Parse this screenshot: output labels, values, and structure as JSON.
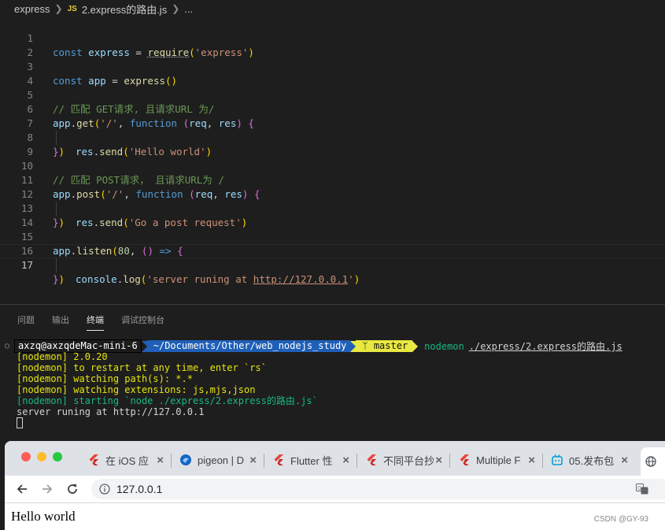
{
  "breadcrumb": {
    "folder": "express",
    "file_badge": "JS",
    "file": "2.express的路由.js",
    "more": "..."
  },
  "editor": {
    "lines": [
      {
        "n": "1"
      },
      {
        "n": "2"
      },
      {
        "n": "3"
      },
      {
        "n": "4"
      },
      {
        "n": "5"
      },
      {
        "n": "6"
      },
      {
        "n": "7"
      },
      {
        "n": "8"
      },
      {
        "n": "9"
      },
      {
        "n": "10"
      },
      {
        "n": "11"
      },
      {
        "n": "12"
      },
      {
        "n": "13"
      },
      {
        "n": "14"
      },
      {
        "n": "15"
      },
      {
        "n": "16"
      },
      {
        "n": "17"
      }
    ],
    "tokens": {
      "const": "const",
      "express": "express",
      "eq": " = ",
      "require": "require",
      "s_express": "'express'",
      "app": "app",
      "express_fn": "express",
      "c1": "// 匹配 GET请求, 且请求URL 为/",
      "get": "get",
      "s_root": "'/'",
      "function": "function",
      "req": "req",
      "res": "res",
      "send": "send",
      "s_hello": "'Hello world'",
      "c2": "// 匹配 POST请求， 且请求URL为 /",
      "post": "post",
      "s_post": "'Go a post request'",
      "listen": "listen",
      "n80": "80",
      "arrow": " => ",
      "console": "console",
      "log": "log",
      "s_srv_a": "'server runing at ",
      "s_srv_url": "http://127.0.0.1",
      "s_srv_b": "'"
    }
  },
  "panel": {
    "tabs": [
      {
        "label": "问题"
      },
      {
        "label": "输出"
      },
      {
        "label": "终端"
      },
      {
        "label": "调试控制台"
      }
    ]
  },
  "terminal": {
    "user": "axzq@axzqdeMac-mini-6",
    "path": "~/Documents/Other/web_nodejs_study",
    "branch": "ᛘ master",
    "command": "nodemon",
    "command_arg": "./express/2.express的路由.js",
    "output": [
      "[nodemon] 2.0.20",
      "[nodemon] to restart at any time, enter `rs`",
      "[nodemon] watching path(s): *.*",
      "[nodemon] watching extensions: js,mjs,json",
      "[nodemon] starting `node ./express/2.express的路由.js`",
      "server runing at http://127.0.0.1"
    ]
  },
  "browser": {
    "tabs": [
      {
        "title": "在 iOS 应"
      },
      {
        "title": "pigeon | D"
      },
      {
        "title": "Flutter 性"
      },
      {
        "title": "不同平台抄"
      },
      {
        "title": "Multiple F"
      },
      {
        "title": "05.发布包"
      }
    ],
    "address": "127.0.0.1",
    "page_text": "Hello world",
    "watermark": "CSDN @GY-93"
  }
}
